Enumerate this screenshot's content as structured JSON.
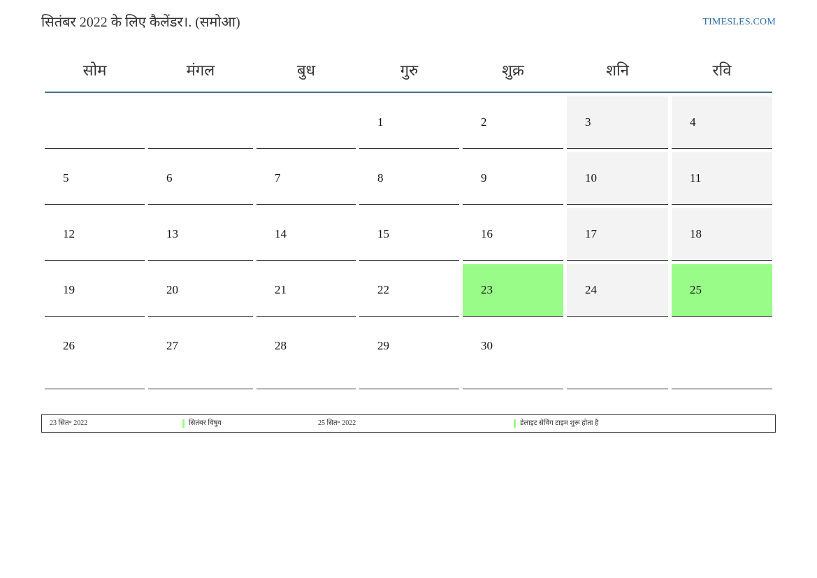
{
  "header": {
    "title": "सितंबर 2022 के लिए कैलेंडर।. (समोआ)",
    "site": "TIMESLES.COM"
  },
  "weekdays": [
    "सोम",
    "मंगल",
    "बुध",
    "गुरु",
    "शुक्र",
    "शनि",
    "रवि"
  ],
  "weeks": [
    [
      "",
      "",
      "",
      "1",
      "2",
      "3",
      "4"
    ],
    [
      "5",
      "6",
      "7",
      "8",
      "9",
      "10",
      "11"
    ],
    [
      "12",
      "13",
      "14",
      "15",
      "16",
      "17",
      "18"
    ],
    [
      "19",
      "20",
      "21",
      "22",
      "23",
      "24",
      "25"
    ],
    [
      "26",
      "27",
      "28",
      "29",
      "30",
      "",
      ""
    ]
  ],
  "colors": {
    "weekend_bg": "#f3f3f3",
    "holiday_bg": "#99fc88",
    "header_rule": "#4a6b8f",
    "link": "#2e6da4"
  },
  "holidays": [
    "23",
    "25"
  ],
  "legend": [
    {
      "date": "23 सित॰ 2022",
      "name": "सितंबर विषुव"
    },
    {
      "date": "25 सित॰ 2022",
      "name": "डेलाइट सेविंग टाइम शुरू होता है"
    }
  ]
}
